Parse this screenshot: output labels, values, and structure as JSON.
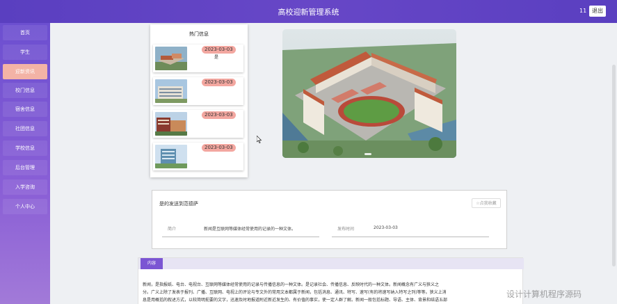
{
  "header": {
    "title": "高校迎新管理系统",
    "user": "11",
    "logout_label": "退出"
  },
  "sidebar": {
    "items": [
      {
        "label": "首页",
        "active": false
      },
      {
        "label": "学生",
        "active": false
      },
      {
        "label": "迎新资讯",
        "active": true
      },
      {
        "label": "校门信息",
        "active": false
      },
      {
        "label": "宿舍信息",
        "active": false
      },
      {
        "label": "社团信息",
        "active": false
      },
      {
        "label": "学校信息",
        "active": false
      },
      {
        "label": "后台管理",
        "active": false
      },
      {
        "label": "入学咨询",
        "active": false
      },
      {
        "label": "个人中心",
        "active": false
      }
    ]
  },
  "hot": {
    "title": "热门信息",
    "items": [
      {
        "date": "2023-03-03",
        "text": "是"
      },
      {
        "date": "2023-03-03",
        "text": ""
      },
      {
        "date": "2023-03-03",
        "text": ""
      },
      {
        "date": "2023-03-03",
        "text": ""
      }
    ]
  },
  "detail": {
    "title": "是的发送到范德萨",
    "collect_label": "☆点我收藏",
    "intro_label": "简介",
    "intro_value": "新闻是互联网等媒体经常使用的记录的一种文体。",
    "time_label": "发布时间",
    "time_value": "2023-03-03"
  },
  "content": {
    "tab_label": "内容",
    "text_line1": "新闻，是指报纸、电台、电视台、互联网等媒体经常使用的记录与传播信息的一种文体。是记录社会、传播信息、反映时代的一种文体。新闻概念有广义与狭义之",
    "text_line2": "分。广义上除了发表于报刊、广播、互联网、电视上的评论与专文外的常用文本都属于新闻，包括消息、通讯、特写、速写(有的将速写纳入特写之列)等等。狭义上消",
    "text_line3": "息是用概括的叙述方式，以较简明扼要的文字，迅速及时地报道附近新近发生的、有价值的事实，使一定人群了解。新闻一般包括标题、导语、主体、背景和结语五部"
  },
  "watermark": "设计计算机程序源码"
}
